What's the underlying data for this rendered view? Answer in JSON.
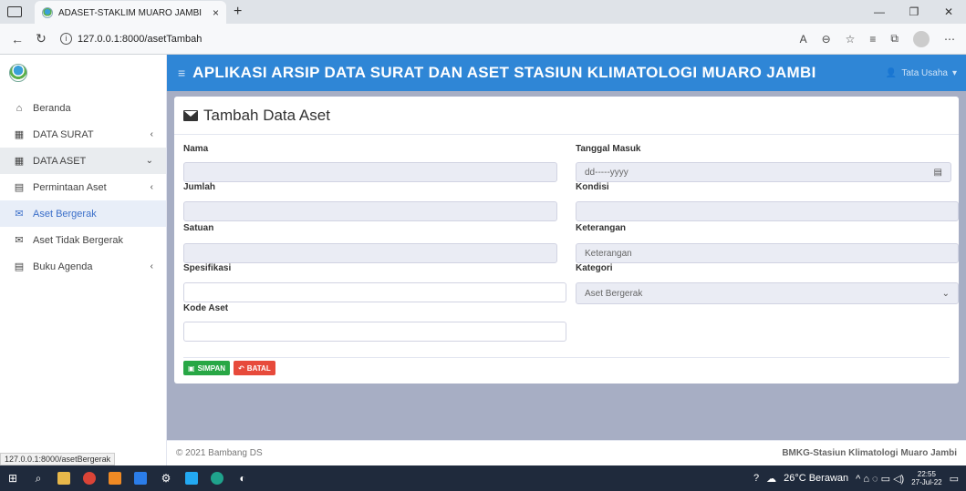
{
  "browser": {
    "tab_title": "ADASET-STAKLIM MUARO JAMBI",
    "tab_close": "×",
    "new_tab": "+",
    "url": "127.0.0.1:8000/asetTambah",
    "status_url": "127.0.0.1:8000/asetBergerak"
  },
  "header": {
    "title": "APLIKASI ARSIP DATA SURAT DAN ASET STASIUN KLIMATOLOGI MUARO JAMBI",
    "user_name": "Tata Usaha"
  },
  "sidebar": {
    "items": [
      {
        "label": "Beranda"
      },
      {
        "label": "DATA SURAT"
      },
      {
        "label": "DATA ASET"
      },
      {
        "label": "Permintaan Aset"
      },
      {
        "label": "Aset Bergerak"
      },
      {
        "label": "Aset Tidak Bergerak"
      },
      {
        "label": "Buku Agenda"
      }
    ]
  },
  "form": {
    "title": "Tambah Data Aset",
    "fields": {
      "nama": {
        "label": "Nama",
        "value": ""
      },
      "tanggal_masuk": {
        "label": "Tanggal Masuk",
        "placeholder": "dd-----yyyy"
      },
      "jumlah": {
        "label": "Jumlah",
        "value": ""
      },
      "kondisi": {
        "label": "Kondisi",
        "value": ""
      },
      "satuan": {
        "label": "Satuan",
        "value": ""
      },
      "keterangan": {
        "label": "Keterangan",
        "placeholder": "Keterangan"
      },
      "spesifikasi": {
        "label": "Spesifikasi",
        "value": ""
      },
      "kategori": {
        "label": "Kategori",
        "selected": "Aset Bergerak"
      },
      "kode_aset": {
        "label": "Kode Aset",
        "value": ""
      }
    },
    "save_label": "SIMPAN",
    "cancel_label": "BATAL"
  },
  "footer": {
    "copyright": "© 2021 Bambang DS",
    "org": "BMKG-Stasiun Klimatologi Muaro Jambi"
  },
  "taskbar": {
    "weather": "26°C  Berawan",
    "time": "22:55",
    "date": "27-Jul-22"
  },
  "colors": {
    "topbar": "#2f86d6",
    "content_bg": "#a7aec4",
    "save": "#28a745",
    "cancel": "#e74a3b",
    "active_link": "#3b6fc9"
  }
}
